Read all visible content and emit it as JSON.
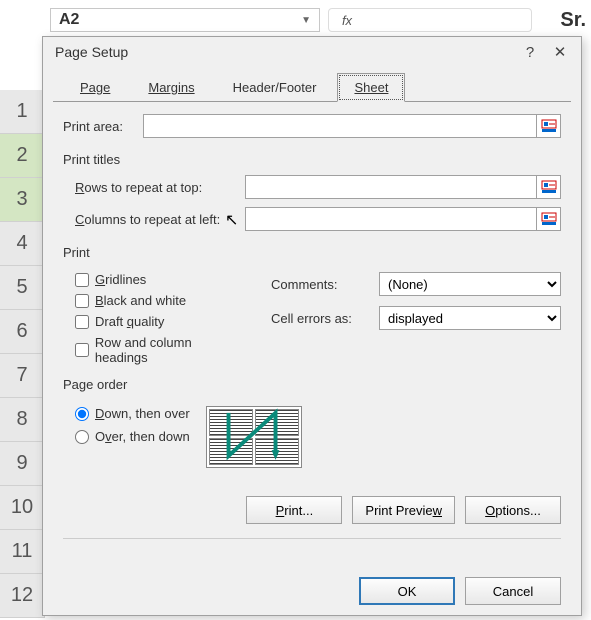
{
  "formula_bar": {
    "cell_ref": "A2",
    "fx_label": "fx",
    "cell_value": "Sr."
  },
  "rows": [
    "1",
    "2",
    "3",
    "4",
    "5",
    "6",
    "7",
    "8",
    "9",
    "10",
    "11",
    "12"
  ],
  "dialog": {
    "title": "Page Setup",
    "help_icon": "?",
    "close_icon": "✕",
    "tabs": {
      "page": "Page",
      "margins": "Margins",
      "header_footer": "Header/Footer",
      "sheet": "Sheet"
    },
    "print_area_label": "Print area:",
    "print_area_value": "",
    "print_titles_label": "Print titles",
    "rows_repeat_label": "Rows to repeat at top:",
    "rows_repeat_value": "",
    "cols_repeat_label": "Columns to repeat at left:",
    "cols_repeat_value": "",
    "print_label": "Print",
    "chk_gridlines": "Gridlines",
    "chk_bw": "Black and white",
    "chk_draft": "Draft quality",
    "chk_rowcol": "Row and column headings",
    "comments_label": "Comments:",
    "comments_value": "(None)",
    "cellerrors_label": "Cell errors as:",
    "cellerrors_value": "displayed",
    "page_order_label": "Page order",
    "radio_down": "Down, then over",
    "radio_over": "Over, then down",
    "btn_print": "Print...",
    "btn_preview": "Print Preview",
    "btn_options": "Options...",
    "btn_ok": "OK",
    "btn_cancel": "Cancel"
  }
}
